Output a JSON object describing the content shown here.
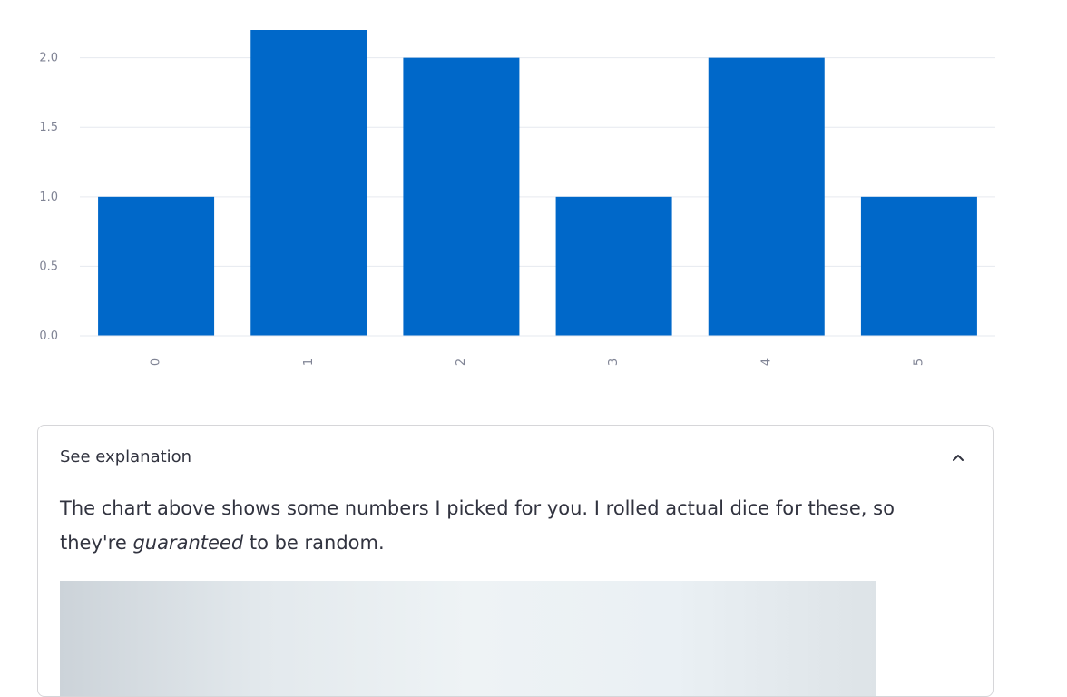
{
  "chart_data": {
    "type": "bar",
    "categories": [
      "0",
      "1",
      "2",
      "3",
      "4",
      "5"
    ],
    "values": [
      1,
      2.2,
      2,
      1,
      2,
      1
    ],
    "title": "",
    "xlabel": "",
    "ylabel": "",
    "ylim": [
      0,
      2.2
    ],
    "yticks": [
      "0.0",
      "0.5",
      "1.0",
      "1.5",
      "2.0"
    ],
    "bar_color": "#0068c9",
    "grid": true
  },
  "expander": {
    "title": "See explanation",
    "expanded": true,
    "chevron_icon": "chevron-up-icon",
    "text_before": "The chart above shows some numbers I picked for you. I rolled actual dice for these, so they're ",
    "text_emphasis": "guaranteed",
    "text_after": " to be random."
  }
}
